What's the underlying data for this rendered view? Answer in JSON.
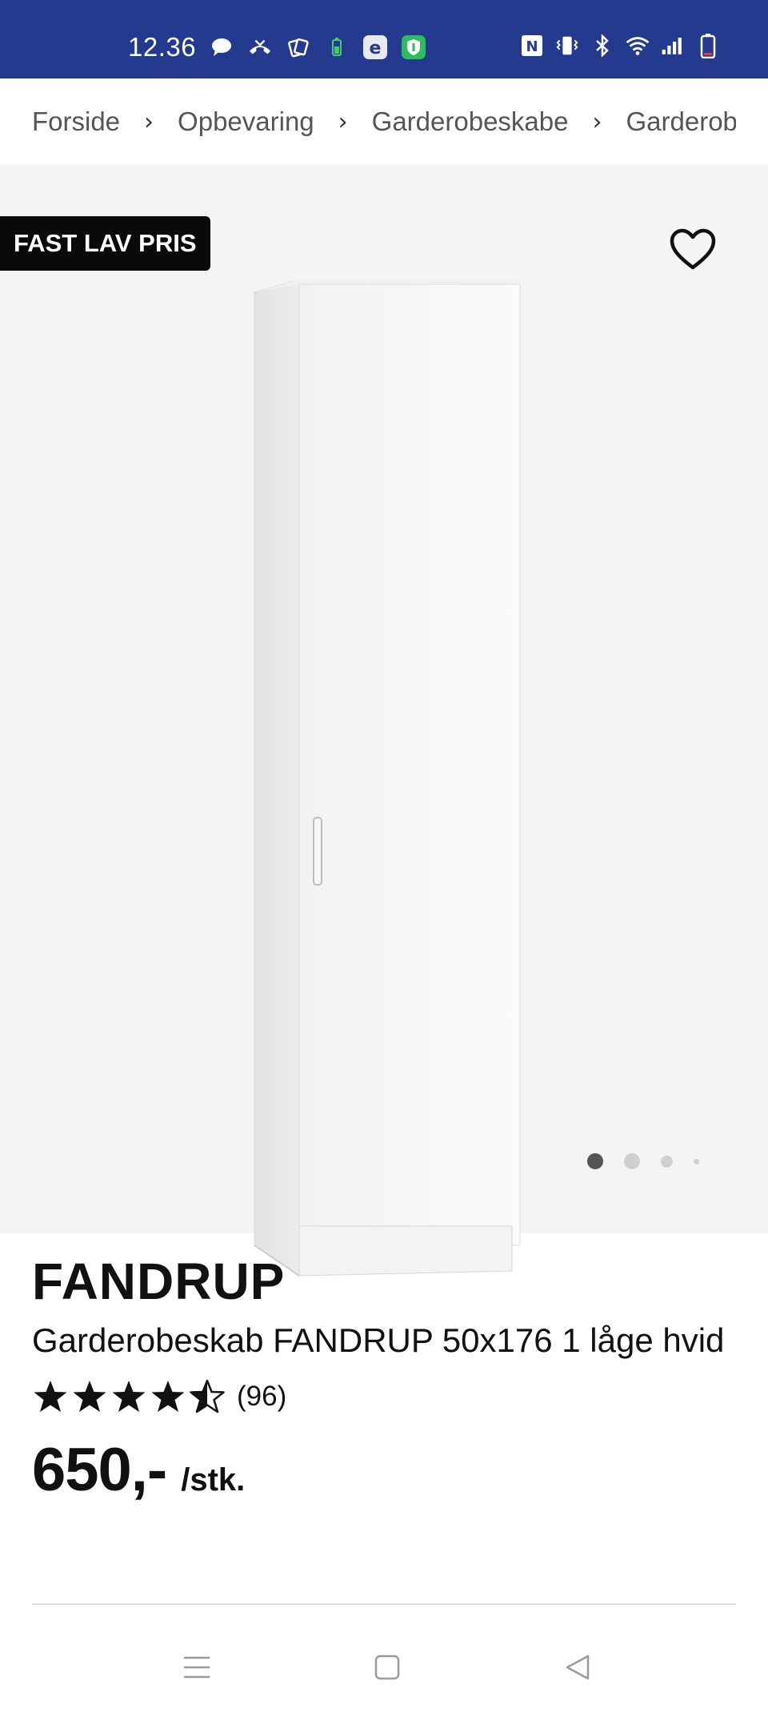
{
  "status_bar": {
    "time": "12.36",
    "left_icons": [
      "chat-icon",
      "missed-call-icon",
      "cards-icon",
      "battery-saver-icon",
      "e-app-icon",
      "shield-app-icon"
    ],
    "right_icons": [
      "nfc-icon",
      "vibrate-icon",
      "bluetooth-icon",
      "wifi-icon",
      "signal-icon",
      "battery-icon"
    ],
    "background": "#243a8f"
  },
  "breadcrumb": {
    "items": [
      "Forside",
      "Opbevaring",
      "Garderobeskabe",
      "Garderobeskabe"
    ],
    "separator": "›"
  },
  "gallery": {
    "badge": "FAST LAV PRIS",
    "favorite_icon": "heart-outline-icon",
    "active_index": 0,
    "image_count": 4
  },
  "product": {
    "brand": "FANDRUP",
    "name": "Garderobeskab FANDRUP 50x176 1 låge hvid",
    "rating": 4.5,
    "rating_count": "(96)",
    "price": "650,-",
    "unit": "/stk."
  },
  "nav_bar": {
    "icons": [
      "menu-icon",
      "home-square-icon",
      "back-triangle-icon"
    ]
  }
}
